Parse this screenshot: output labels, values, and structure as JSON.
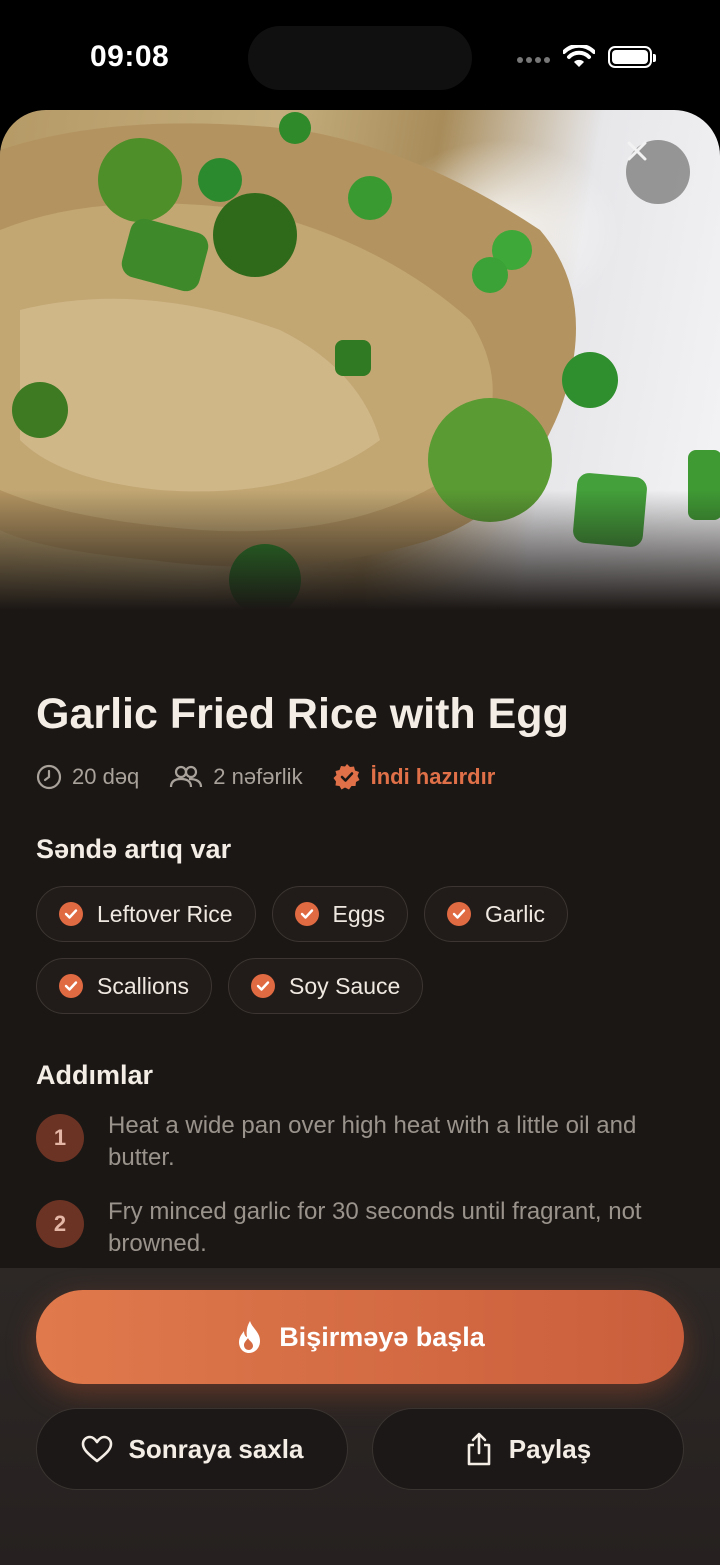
{
  "status": {
    "time": "09:08"
  },
  "recipe": {
    "title": "Garlic Fried Rice with Egg",
    "time": "20 dəq",
    "servings": "2 nəfərlik",
    "ready": "İndi hazırdır"
  },
  "have": {
    "title": "Səndə artıq var",
    "items": [
      "Leftover Rice",
      "Eggs",
      "Garlic",
      "Scallions",
      "Soy Sauce"
    ]
  },
  "steps": {
    "title": "Addımlar",
    "items": [
      {
        "num": "1",
        "text": "Heat a wide pan over high heat with a little oil and butter."
      },
      {
        "num": "2",
        "text": "Fry minced garlic for 30 seconds until fragrant, not browned."
      }
    ]
  },
  "actions": {
    "start": "Bişirməyə başla",
    "save": "Sonraya saxla",
    "share": "Paylaş"
  },
  "colors": {
    "accent": "#e07048",
    "background": "#1b1715"
  },
  "icons": [
    "close-icon",
    "clock-icon",
    "people-icon",
    "verified-badge-icon",
    "check-icon",
    "flame-icon",
    "heart-icon",
    "share-icon",
    "wifi-icon",
    "battery-icon"
  ]
}
